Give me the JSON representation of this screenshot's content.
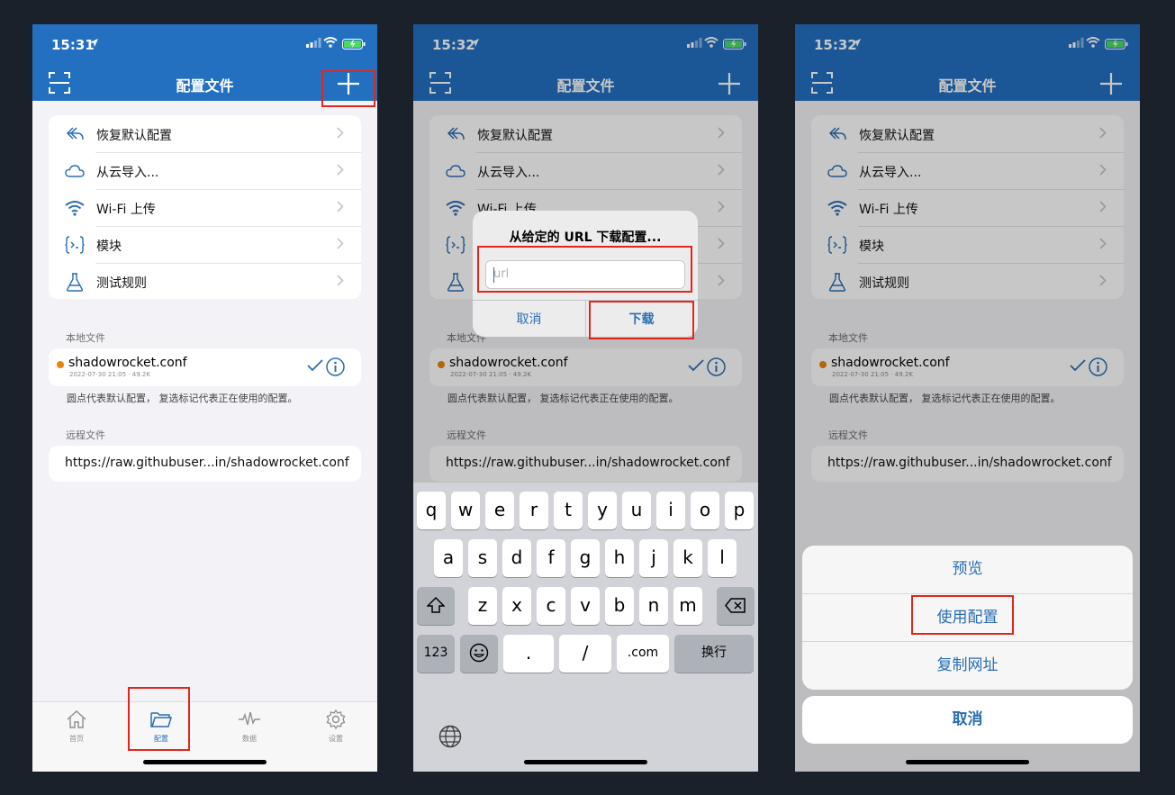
{
  "status": {
    "time1": "15:31",
    "time2": "15:32",
    "time3": "15:32"
  },
  "nav": {
    "title": "配置文件"
  },
  "menu": [
    {
      "label": "恢复默认配置",
      "icon": "undo-icon"
    },
    {
      "label": "从云导入...",
      "icon": "cloud-icon"
    },
    {
      "label": "Wi-Fi 上传",
      "icon": "wifi-icon"
    },
    {
      "label": "模块",
      "icon": "module-icon"
    },
    {
      "label": "测试规则",
      "icon": "flask-icon"
    }
  ],
  "local": {
    "section": "本地文件",
    "file_name": "shadowrocket.conf",
    "file_meta": "2022-07-30 21:05 · 49.2K",
    "note": "圆点代表默认配置， 复选标记代表正在使用的配置。"
  },
  "remote": {
    "section": "远程文件",
    "url": "https://raw.githubuser...in/shadowrocket.conf"
  },
  "tabs": [
    {
      "label": "首页",
      "icon": "home-icon"
    },
    {
      "label": "配置",
      "icon": "folder-icon"
    },
    {
      "label": "数据",
      "icon": "pulse-icon"
    },
    {
      "label": "设置",
      "icon": "gear-icon"
    }
  ],
  "dialog": {
    "title": "从给定的 URL 下载配置...",
    "placeholder": "url",
    "cancel": "取消",
    "download": "下载"
  },
  "keyboard": {
    "row1": [
      "q",
      "w",
      "e",
      "r",
      "t",
      "y",
      "u",
      "i",
      "o",
      "p"
    ],
    "row2": [
      "a",
      "s",
      "d",
      "f",
      "g",
      "h",
      "j",
      "k",
      "l"
    ],
    "row3": [
      "z",
      "x",
      "c",
      "v",
      "b",
      "n",
      "m"
    ],
    "num": "123",
    "dot": ".",
    "slash": "/",
    "com": ".com",
    "return": "换行"
  },
  "sheet": {
    "preview": "预览",
    "use": "使用配置",
    "copy": "复制网址",
    "cancel": "取消"
  },
  "colors": {
    "accent": "#2370c1",
    "highlight": "#e2261c",
    "dot": "#e6840e"
  }
}
